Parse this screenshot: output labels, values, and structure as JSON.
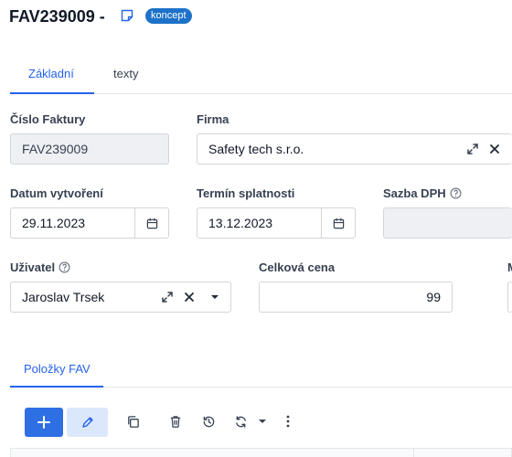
{
  "header": {
    "title": "FAV239009 -",
    "status_badge": "koncept"
  },
  "tabs": [
    {
      "label": "Základní",
      "active": true
    },
    {
      "label": "texty",
      "active": false
    }
  ],
  "form": {
    "cislo_faktury": {
      "label": "Číslo Faktury",
      "value": "FAV239009"
    },
    "firma": {
      "label": "Firma",
      "value": "Safety tech s.r.o."
    },
    "datum_vytvoreni": {
      "label": "Datum vytvoření",
      "value": "29.11.2023"
    },
    "termin_splatnosti": {
      "label": "Termín splatnosti",
      "value": "13.12.2023"
    },
    "sazba_dph": {
      "label": "Sazba DPH",
      "value": ""
    },
    "uzivatel": {
      "label": "Uživatel",
      "value": "Jaroslav Trsek"
    },
    "celkova_cena": {
      "label": "Celková cena",
      "value": "99"
    },
    "cut_label": "M"
  },
  "items_tab": {
    "label": "Položky FAV"
  },
  "toolbar": {
    "add_icon": "plus-icon",
    "edit_icon": "pencil-icon",
    "copy_icon": "copy-icon",
    "delete_icon": "trash-icon",
    "history_icon": "history-icon",
    "refresh_icon": "refresh-icon",
    "more_icon": "more-vertical-icon"
  },
  "colors": {
    "accent": "#2563eb",
    "badge": "#1d72c8",
    "add_button": "#2f6fe4",
    "edit_button": "#dbe7fb"
  }
}
